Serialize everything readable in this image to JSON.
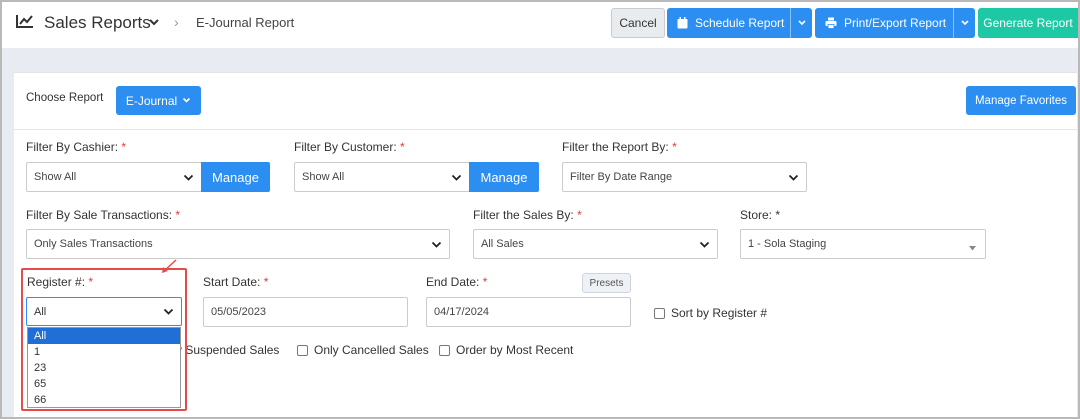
{
  "header": {
    "title": "Sales Reports",
    "breadcrumb": "E-Journal Report",
    "buttons": {
      "cancel": "Cancel",
      "schedule": "Schedule Report",
      "print": "Print/Export Report",
      "generate": "Generate Report"
    }
  },
  "choose": {
    "label": "Choose Report",
    "report": "E-Journal",
    "favorites": "Manage Favorites"
  },
  "filters": {
    "cashier": {
      "label": "Filter By Cashier:",
      "value": "Show All",
      "manage": "Manage"
    },
    "customer": {
      "label": "Filter By Customer:",
      "value": "Show All",
      "manage": "Manage"
    },
    "report_by": {
      "label": "Filter the Report By:",
      "value": "Filter By Date Range"
    },
    "sale_transactions": {
      "label": "Filter By Sale Transactions:",
      "value": "Only Sales Transactions"
    },
    "sales_by": {
      "label": "Filter the Sales By:",
      "value": "All Sales"
    },
    "store": {
      "label": "Store:",
      "value": "1 - Sola Staging"
    },
    "register": {
      "label": "Register #:",
      "value": "All",
      "options": [
        "All",
        "1",
        "23",
        "65",
        "66"
      ]
    },
    "start_date": {
      "label": "Start Date:",
      "value": "05/05/2023"
    },
    "end_date": {
      "label": "End Date:",
      "value": "04/17/2024"
    },
    "presets": "Presets",
    "required_mark": "*"
  },
  "checkboxes": {
    "sort_register": "Sort by Register #",
    "suspended": "y Suspended Sales",
    "cancelled": "Only Cancelled Sales",
    "recent": "Order by Most Recent"
  },
  "colors": {
    "primary": "#2b8ef0",
    "generate": "#1dc9a5",
    "highlight": "#e54b4b",
    "required": "#e03a3a"
  }
}
